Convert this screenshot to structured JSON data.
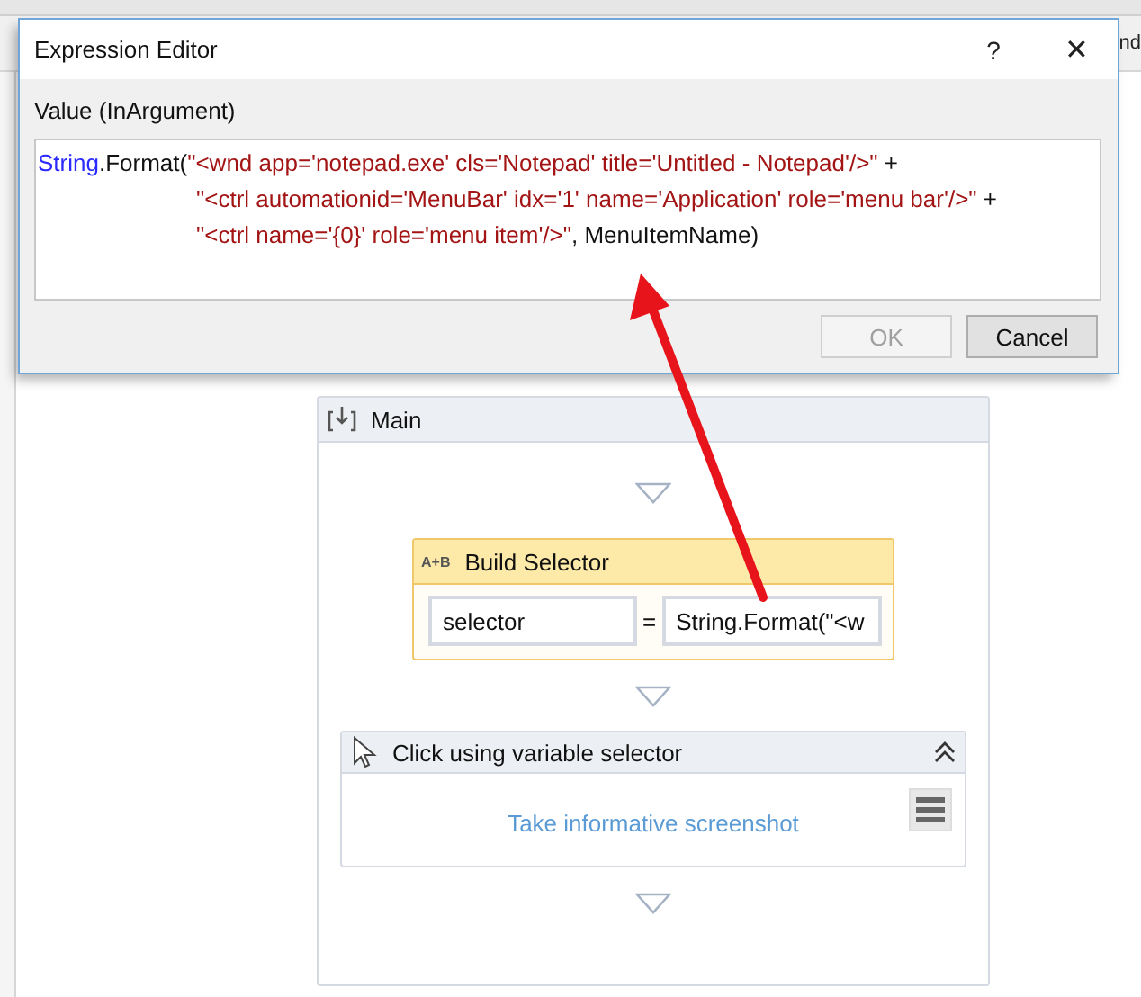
{
  "background_tab": {
    "text": "nd"
  },
  "dialog": {
    "title": "Expression Editor",
    "help": "?",
    "close": "✕",
    "field_label": "Value (InArgument)",
    "code_lines": [
      {
        "indented": false,
        "tokens": [
          {
            "kind": "type",
            "text": "String"
          },
          {
            "kind": "plain",
            "text": ".Format("
          },
          {
            "kind": "string",
            "text": "\"<wnd app='notepad.exe' cls='Notepad' title='Untitled - Notepad'/>\""
          },
          {
            "kind": "plain",
            "text": "  +"
          }
        ]
      },
      {
        "indented": true,
        "tokens": [
          {
            "kind": "string",
            "text": "\"<ctrl automationid='MenuBar' idx='1' name='Application' role='menu bar'/>\""
          },
          {
            "kind": "plain",
            "text": " +"
          }
        ]
      },
      {
        "indented": true,
        "tokens": [
          {
            "kind": "string",
            "text": "\"<ctrl name='{0}' role='menu item'/>\""
          },
          {
            "kind": "plain",
            "text": ", MenuItemName)"
          }
        ]
      }
    ],
    "buttons": [
      {
        "label": "OK",
        "disabled": true
      },
      {
        "label": "Cancel",
        "disabled": false
      }
    ]
  },
  "sequence": {
    "title": "Main",
    "assign": {
      "title": "Build Selector",
      "icon_text": "A+B",
      "target": "selector",
      "equals": "=",
      "value": "String.Format(\"<w"
    },
    "click": {
      "title": "Click using variable selector",
      "link": "Take informative screenshot"
    }
  }
}
